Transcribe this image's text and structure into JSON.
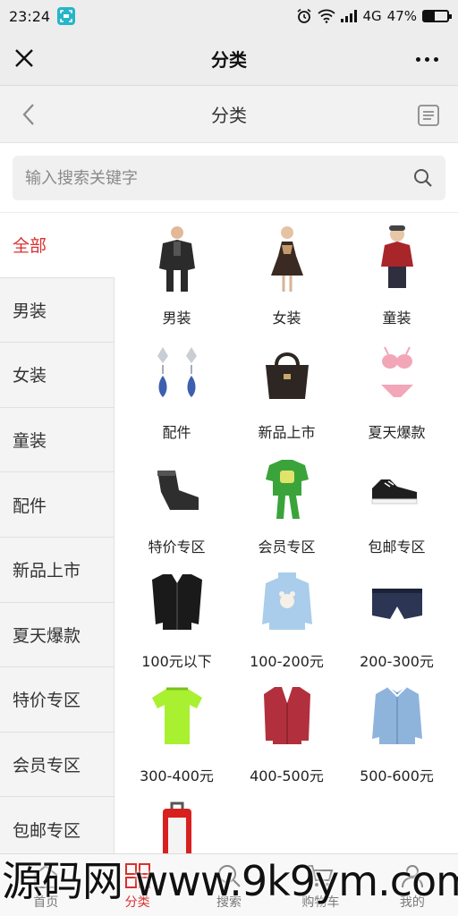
{
  "status_bar": {
    "time": "23:24",
    "network": "4G",
    "battery": "47%"
  },
  "wechat_bar": {
    "title": "分类"
  },
  "header": {
    "title": "分类"
  },
  "search": {
    "placeholder": "输入搜索关键字"
  },
  "sidebar": {
    "items": [
      {
        "label": "全部",
        "active": true
      },
      {
        "label": "男装"
      },
      {
        "label": "女装"
      },
      {
        "label": "童装"
      },
      {
        "label": "配件"
      },
      {
        "label": "新品上市"
      },
      {
        "label": "夏天爆款"
      },
      {
        "label": "特价专区"
      },
      {
        "label": "会员专区"
      },
      {
        "label": "包邮专区"
      }
    ]
  },
  "grid": {
    "items": [
      {
        "label": "男装",
        "icon": "mens-clothing-photo",
        "color": "#2b2b2b"
      },
      {
        "label": "女装",
        "icon": "womens-clothing-photo",
        "color": "#3a2a22"
      },
      {
        "label": "童装",
        "icon": "kids-clothing-photo",
        "color": "#a8252a"
      },
      {
        "label": "配件",
        "icon": "earrings-photo",
        "color": "#3d5fb0"
      },
      {
        "label": "新品上市",
        "icon": "handbag-photo",
        "color": "#2d2622"
      },
      {
        "label": "夏天爆款",
        "icon": "bikini-photo",
        "color": "#f2a6b8"
      },
      {
        "label": "特价专区",
        "icon": "socks-photo",
        "color": "#2e2e2e"
      },
      {
        "label": "会员专区",
        "icon": "kids-pajamas-photo",
        "color": "#3aa43a"
      },
      {
        "label": "包邮专区",
        "icon": "sneakers-photo",
        "color": "#1e1e1e"
      },
      {
        "label": "100元以下",
        "icon": "black-cardigan-photo",
        "color": "#1a1a1a"
      },
      {
        "label": "100-200元",
        "icon": "blue-sweater-photo",
        "color": "#a9cdea"
      },
      {
        "label": "200-300元",
        "icon": "boxer-briefs-photo",
        "color": "#2c3553"
      },
      {
        "label": "300-400元",
        "icon": "sport-tshirt-photo",
        "color": "#a8f030"
      },
      {
        "label": "400-500元",
        "icon": "red-cardigan-photo",
        "color": "#b2303d"
      },
      {
        "label": "500-600元",
        "icon": "blue-shirt-photo",
        "color": "#8fb4dc"
      },
      {
        "label": "",
        "icon": "red-suitcase-photo",
        "color": "#d8201e"
      }
    ]
  },
  "tabbar": {
    "items": [
      {
        "label": "首页",
        "icon": "home-icon"
      },
      {
        "label": "分类",
        "icon": "category-icon",
        "active": true
      },
      {
        "label": "搜索",
        "icon": "search-icon"
      },
      {
        "label": "购物车",
        "icon": "cart-icon"
      },
      {
        "label": "我的",
        "icon": "user-icon"
      }
    ]
  },
  "watermark": {
    "text": "源码网 www.9k9ym.com"
  },
  "colors": {
    "accent": "#d9302f",
    "background": "#ffffff",
    "sidebar_bg": "#f4f4f4"
  }
}
